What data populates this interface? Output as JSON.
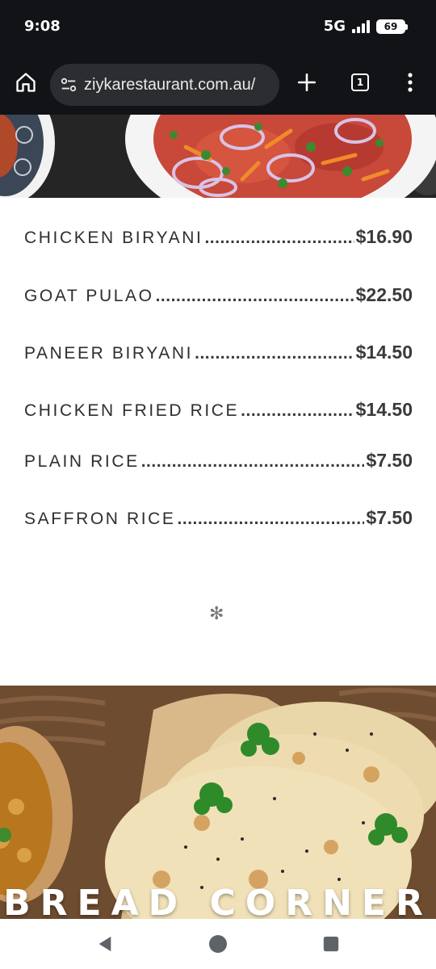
{
  "status_bar": {
    "time": "9:08",
    "network": "5G",
    "battery": "69"
  },
  "browser": {
    "url": "ziykarestaurant.com.au/",
    "tab_count": "1",
    "icons": [
      "home-icon",
      "site-info-icon",
      "new-tab-icon",
      "tab-switcher-icon",
      "more-menu-icon"
    ]
  },
  "menu": {
    "items": [
      {
        "name": "CHICKEN BIRYANI",
        "price": "$16.90"
      },
      {
        "name": "GOAT PULAO",
        "price": "$22.50"
      },
      {
        "name": "PANEER BIRYANI",
        "price": "$14.50"
      },
      {
        "name": "CHICKEN FRIED RICE",
        "price": "$14.50"
      },
      {
        "name": "PLAIN RICE",
        "price": "$7.50"
      },
      {
        "name": "SAFFRON RICE",
        "price": "$7.50"
      }
    ],
    "divider_glyph": "✻",
    "leader": "....................................................................................."
  },
  "bread_section": {
    "title": "BREAD CORNER"
  },
  "nav": {
    "icons": [
      "back-icon",
      "home-circle-icon",
      "recents-icon"
    ]
  },
  "colors": {
    "status_bg": "#121316",
    "url_pill": "#2b2d31",
    "menu_text": "#2e2e2e",
    "nav_icon": "#5f6368"
  }
}
